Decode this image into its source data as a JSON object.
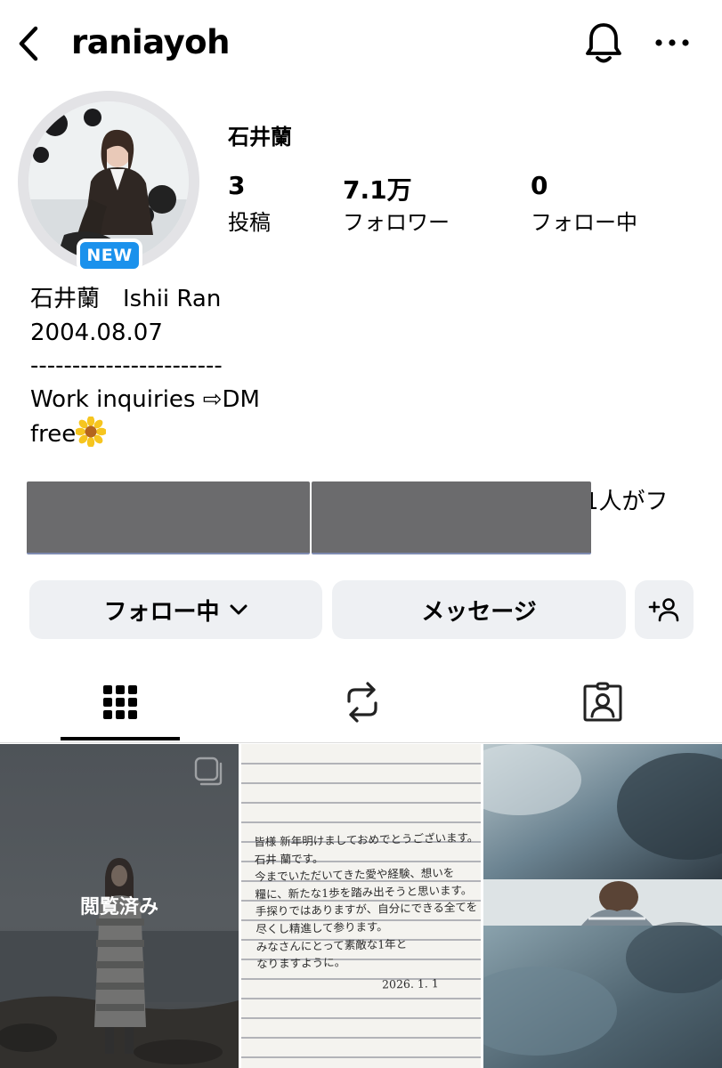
{
  "header": {
    "back_icon": "chevron-left-icon",
    "username": "raniayoh",
    "notification_icon": "bell-icon",
    "more_icon": "ellipsis-icon"
  },
  "profile": {
    "avatar_badge": "NEW",
    "display_name": "石井蘭",
    "stats": {
      "posts": {
        "value": "3",
        "label": "投稿"
      },
      "followers": {
        "value": "7.1万",
        "label": "フォロワー"
      },
      "following": {
        "value": "0",
        "label": "フォロー中"
      }
    },
    "bio": [
      "石井蘭　Ishii Ran",
      "2004.08.07",
      "-----------------------",
      "Work inquiries ⇨DM",
      "free"
    ],
    "bio_emoji": "sunflower-icon",
    "mutual_followers_text": "1人がフ"
  },
  "actions": {
    "following_label": "フォロー中",
    "message_label": "メッセージ",
    "add_person_icon": "add-person-icon"
  },
  "tabs": [
    {
      "name": "posts",
      "icon": "grid-icon",
      "active": true
    },
    {
      "name": "reposts",
      "icon": "repost-icon",
      "active": false
    },
    {
      "name": "tagged",
      "icon": "tagged-person-icon",
      "active": false
    }
  ],
  "posts": [
    {
      "overlay_label": "閲覧済み",
      "multi": true
    },
    {
      "handwritten_lines": [
        "皆様 新年明けましておめでとうございます。",
        "石井 蘭です。",
        "今までいただいてきた愛や経験、想いを",
        "糧に、新たな1歩を踏み出そうと思います。",
        "手探りではありますが、自分にできる全てを",
        "尽くし精進して参ります。",
        "みなさんにとって素敵な1年と",
        "なりますように。"
      ],
      "handwritten_date": "2026. 1. 1"
    },
    {
      "overlay_label": ""
    }
  ],
  "colors": {
    "accent": "#1a91ec",
    "button_bg": "#eef0f3",
    "ring": "#e3e3e6"
  }
}
